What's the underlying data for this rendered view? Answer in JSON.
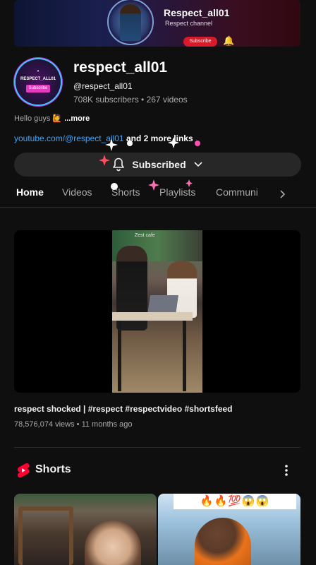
{
  "banner": {
    "title": "Respect_all01",
    "subtitle": "Respect channel",
    "subscribe_label": "Subscribe"
  },
  "avatar": {
    "top_text": "•",
    "name": "RESPECT_ALL01",
    "button_label": "Subscribe"
  },
  "channel": {
    "name": "respect_all01",
    "handle": "@respect_all01",
    "stats": "708K subscribers • 267 videos",
    "description": "Hello guys 🙋",
    "more_label": "...more",
    "link": "youtube.com/@respect_all01",
    "more_links": " and 2 more links"
  },
  "subscribe": {
    "label": "Subscribed"
  },
  "tabs": [
    {
      "label": "Home"
    },
    {
      "label": "Videos"
    },
    {
      "label": "Shorts"
    },
    {
      "label": "Playlists"
    },
    {
      "label": "Communi"
    }
  ],
  "featured_video": {
    "title": "respect shocked | #respect #respectvideo #shortsfeed",
    "meta": "78,576,074 views • 11 months ago",
    "overlay_text": "Zest cafe"
  },
  "shorts": {
    "title": "Shorts",
    "items": [
      {
        "caption": ""
      },
      {
        "caption": "🔥🔥💯😱😱"
      }
    ]
  },
  "colors": {
    "background": "#0f0f0f",
    "link": "#3ea6ff",
    "button_bg": "#272727",
    "shorts_red": "#ff0033",
    "avatar_ring": "#3cc8ff",
    "avatar_button": "#e23bbd"
  },
  "icons": {
    "bell": "bell-icon",
    "chevron": "chevron-down-icon",
    "tabs_arrow": "chevron-right-icon",
    "shorts_logo": "shorts-logo-icon",
    "menu": "more-vert-icon"
  }
}
